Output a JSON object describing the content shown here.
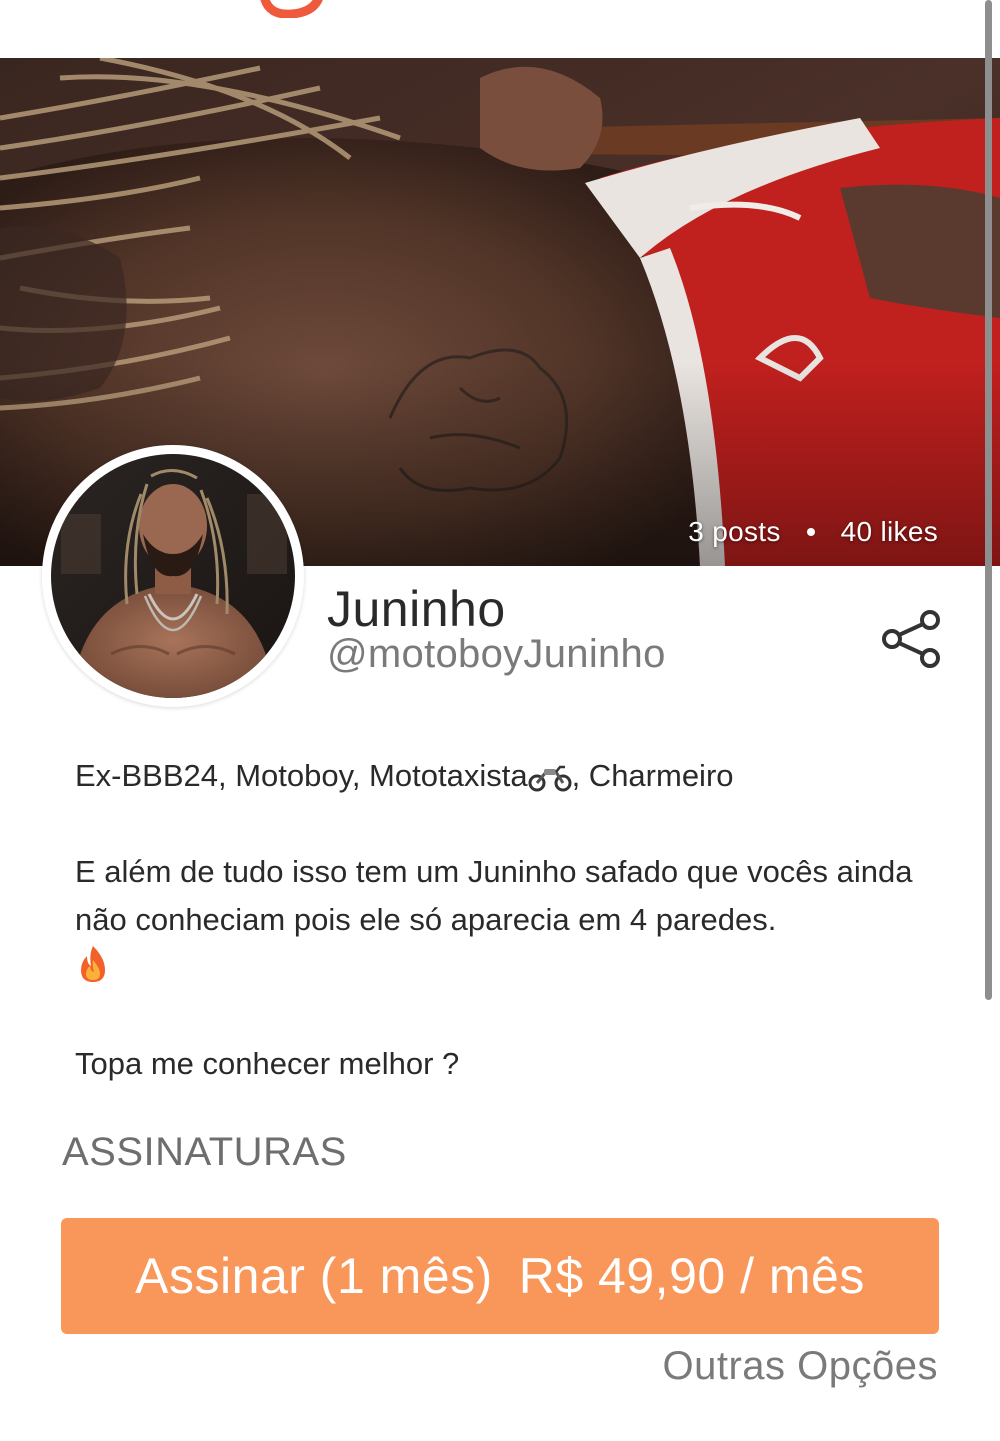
{
  "profile": {
    "display_name": "Juninho",
    "handle": "@motoboyJuninho",
    "stats": {
      "posts": "3 posts",
      "likes": "40 likes"
    }
  },
  "bio": {
    "line1_before_emoji": "Ex-BBB24, Motoboy, Mototaxista",
    "line1_after_emoji": ", Charmeiro",
    "paragraph2": "E além de tudo isso tem um Juninho safado que vocês ainda não conheciam pois ele só aparecia em 4 paredes.",
    "paragraph3": "Topa me conhecer melhor ?",
    "emojis": [
      "motorcycle-icon",
      "fire-icon"
    ]
  },
  "subscriptions": {
    "section_title": "ASSINATURAS",
    "button_label": "Assinar (1 mês)",
    "button_price": "R$ 49,90 / mês",
    "other_options": "Outras Opções"
  },
  "icons": {
    "share": "share-icon"
  },
  "colors": {
    "accent": "#f9975a",
    "brand_logo": "#f05a3c",
    "text_primary": "#2a2a2a",
    "text_secondary": "#7a7a7a"
  }
}
